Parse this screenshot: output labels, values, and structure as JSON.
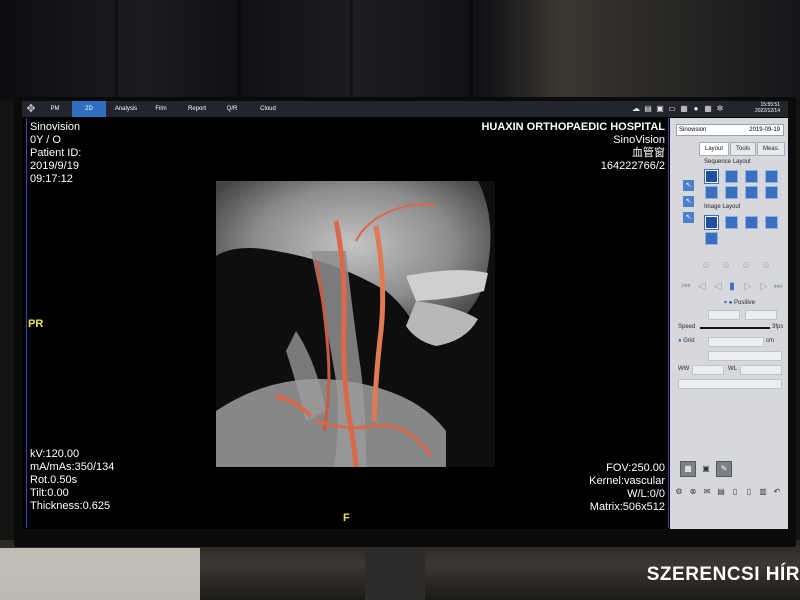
{
  "menubar": {
    "tabs": [
      "PM",
      "2D",
      "Analysis",
      "Film",
      "Report",
      "Q/R",
      "Cloud"
    ],
    "active_tab": "2D",
    "clock_time": "15:55:51",
    "clock_date": "2022/12/14",
    "icons": [
      "cloud-icon",
      "printer-icon",
      "disk-icon",
      "folder-icon",
      "export-icon",
      "circle-icon",
      "grid-icon",
      "gear-icon"
    ]
  },
  "overlay": {
    "top_left": [
      "Sinovision",
      "0Y / O",
      "Patient ID:",
      "2019/9/19",
      "09:17:12"
    ],
    "top_right": [
      "HUAXIN ORTHOPAEDIC HOSPITAL",
      "SinoVision",
      "血管窗",
      "164222766/2"
    ],
    "bottom_left": [
      "kV:120.00",
      "mA/mAs:350/134",
      "Rot.0.50s",
      "Tilt:0.00",
      "Thickness:0.625"
    ],
    "bottom_right": [
      "FOV:250.00",
      "Kernel:vascular",
      "W/L:0/0",
      "Matrix:506x512"
    ],
    "orient_left": "PR",
    "orient_bottom": "F"
  },
  "panel": {
    "header_name": "Sinovision",
    "header_date": "2019-09-19",
    "tabs": [
      "Layout",
      "Tools",
      "Meas."
    ],
    "active_tab": "Layout",
    "sequence_layout_label": "Sequence Layout",
    "image_layout_label": "Image Layout",
    "positive_label": "Positive",
    "speed_label": "Speed",
    "speed_value": "3fps",
    "grid_label": "Grid",
    "grid_unit": "cm",
    "ww_label": "WW",
    "wl_label": "WL"
  },
  "watermark": "SZERENCSI HÍR",
  "colors": {
    "menubar_bg": "#23252d",
    "active_tab": "#2f6fbf",
    "overlay_text": "#ffffff",
    "orientation_text": "#f0e24a",
    "panel_bg": "#d6d8dc",
    "layout_button": "#3a6fc0",
    "vessel": "#d9694a"
  }
}
